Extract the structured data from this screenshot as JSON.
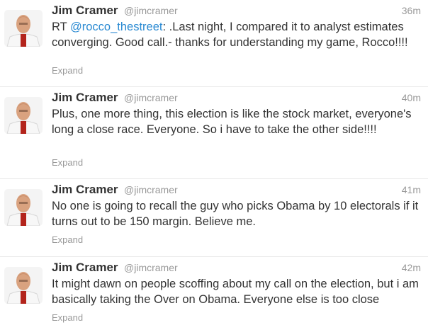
{
  "tweets": [
    {
      "name": "Jim Cramer",
      "handle": "@jimcramer",
      "time": "36m",
      "prefix": "RT ",
      "mention": "@rocco_thestreet",
      "body": ": .Last night, I compared it to analyst estimates converging. Good call.- thanks for understanding my game, Rocco!!!!",
      "expand": "Expand"
    },
    {
      "name": "Jim Cramer",
      "handle": "@jimcramer",
      "time": "40m",
      "body": "Plus, one more thing, this election is like the stock market, everyone's long a close race. Everyone. So i have to take the other side!!!!",
      "expand": "Expand"
    },
    {
      "name": "Jim Cramer",
      "handle": "@jimcramer",
      "time": "41m",
      "body": "No one is going to recall the guy who picks Obama by 10 electorals if it turns out to be 150 margin. Believe me.",
      "expand": "Expand"
    },
    {
      "name": "Jim Cramer",
      "handle": "@jimcramer",
      "time": "42m",
      "body": "It might dawn on people scoffing about my call on the election, but i am basically taking the Over on Obama. Everyone else is too close",
      "expand": "Expand"
    }
  ],
  "colors": {
    "mention": "#2a8ad2",
    "meta": "#999999",
    "text": "#333333"
  }
}
